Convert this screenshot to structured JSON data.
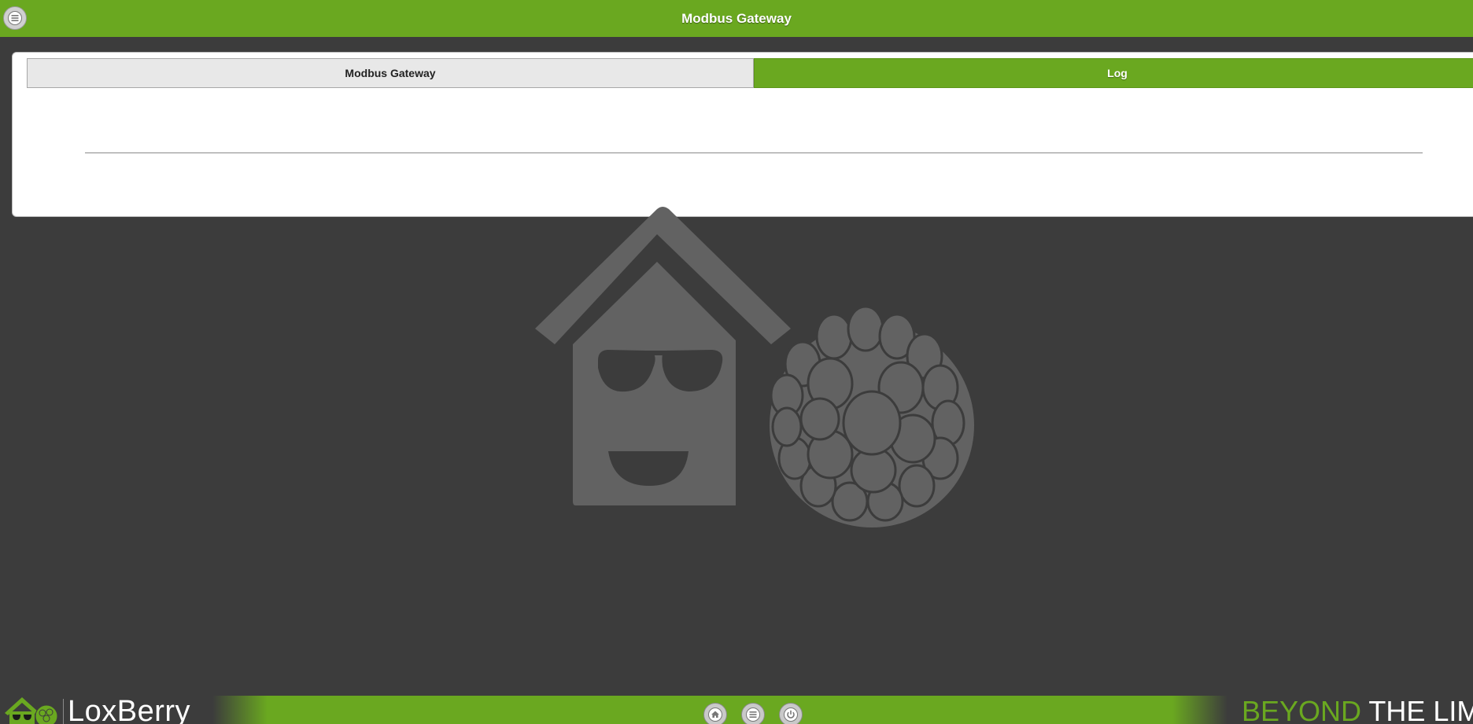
{
  "header": {
    "title": "Modbus Gateway",
    "menu_icon": "hamburger-menu-icon"
  },
  "tabs": [
    {
      "label": "Modbus Gateway",
      "active": false
    },
    {
      "label": "Log",
      "active": true
    }
  ],
  "watermark": {
    "icon": "loxberry-house-raspberry-logo"
  },
  "footer": {
    "brand": "LoxBerry",
    "tagline_part1": "BEYOND",
    "tagline_part2": "THE LIMIT",
    "buttons": [
      {
        "icon": "home-icon"
      },
      {
        "icon": "menu-icon"
      },
      {
        "icon": "power-icon"
      }
    ]
  },
  "colors": {
    "accent": "#6aa820",
    "background": "#3c3c3c",
    "panel": "#ffffff",
    "watermark": "#626262"
  }
}
